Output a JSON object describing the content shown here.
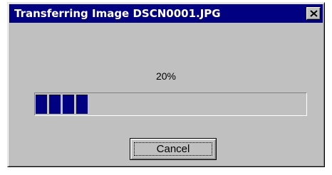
{
  "window": {
    "title": "Transferring Image DSCN0001.JPG",
    "close_icon": "close-icon"
  },
  "progress": {
    "percent_text": "20%",
    "fraction": 0.2,
    "bar_color": "#000080"
  },
  "buttons": {
    "cancel_label": "Cancel"
  },
  "colors": {
    "titlebar": "#000080",
    "face": "#c0c0c0"
  }
}
